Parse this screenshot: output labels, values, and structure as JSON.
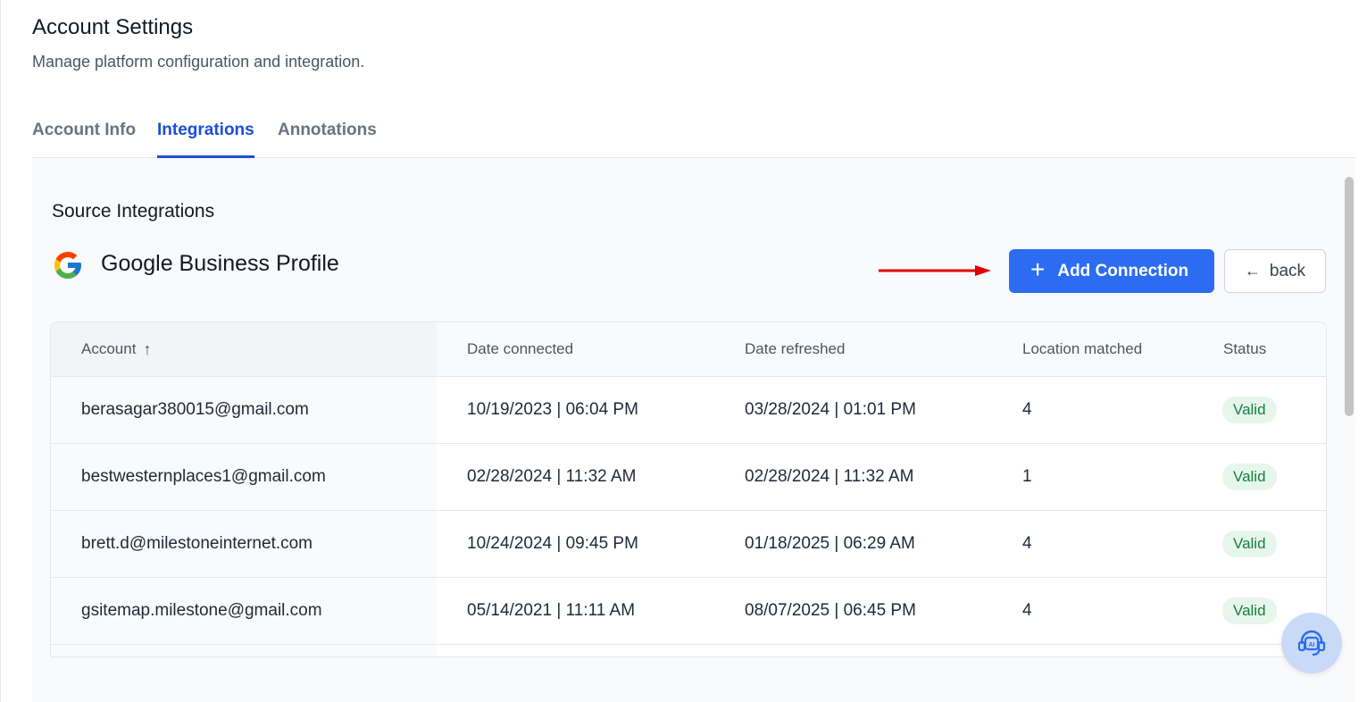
{
  "header": {
    "title": "Account Settings",
    "subtitle": "Manage platform configuration and integration."
  },
  "tabs": [
    {
      "label": "Account Info",
      "active": false
    },
    {
      "label": "Integrations",
      "active": true
    },
    {
      "label": "Annotations",
      "active": false
    }
  ],
  "section": {
    "title": "Source Integrations",
    "provider_name": "Google Business Profile",
    "provider_icon": "google-logo-icon"
  },
  "actions": {
    "add_connection_label": "Add Connection",
    "add_icon": "plus-icon",
    "back_label": "back",
    "back_icon": "arrow-left-icon"
  },
  "table": {
    "columns": [
      "Account",
      "Date connected",
      "Date refreshed",
      "Location matched",
      "Status"
    ],
    "sort_icon": "arrow-up-icon",
    "rows": [
      {
        "account": "berasagar380015@gmail.com",
        "connected": "10/19/2023 | 06:04 PM",
        "refreshed": "03/28/2024 | 01:01 PM",
        "location": "4",
        "status": "Valid"
      },
      {
        "account": "bestwesternplaces1@gmail.com",
        "connected": "02/28/2024 | 11:32 AM",
        "refreshed": "02/28/2024 | 11:32 AM",
        "location": "1",
        "status": "Valid"
      },
      {
        "account": "brett.d@milestoneinternet.com",
        "connected": "10/24/2024 | 09:45 PM",
        "refreshed": "01/18/2025 | 06:29 AM",
        "location": "4",
        "status": "Valid"
      },
      {
        "account": "gsitemap.milestone@gmail.com",
        "connected": "05/14/2021 | 11:11 AM",
        "refreshed": "08/07/2025 | 06:45 PM",
        "location": "4",
        "status": "Valid"
      }
    ]
  },
  "assistant": {
    "icon": "ai-assistant-headset-icon"
  },
  "colors": {
    "accent": "#1d4ed8",
    "button": "#2b6cf3",
    "valid_bg": "#e7f6ec",
    "valid_text": "#15803d",
    "annotation_arrow": "#e00000"
  }
}
